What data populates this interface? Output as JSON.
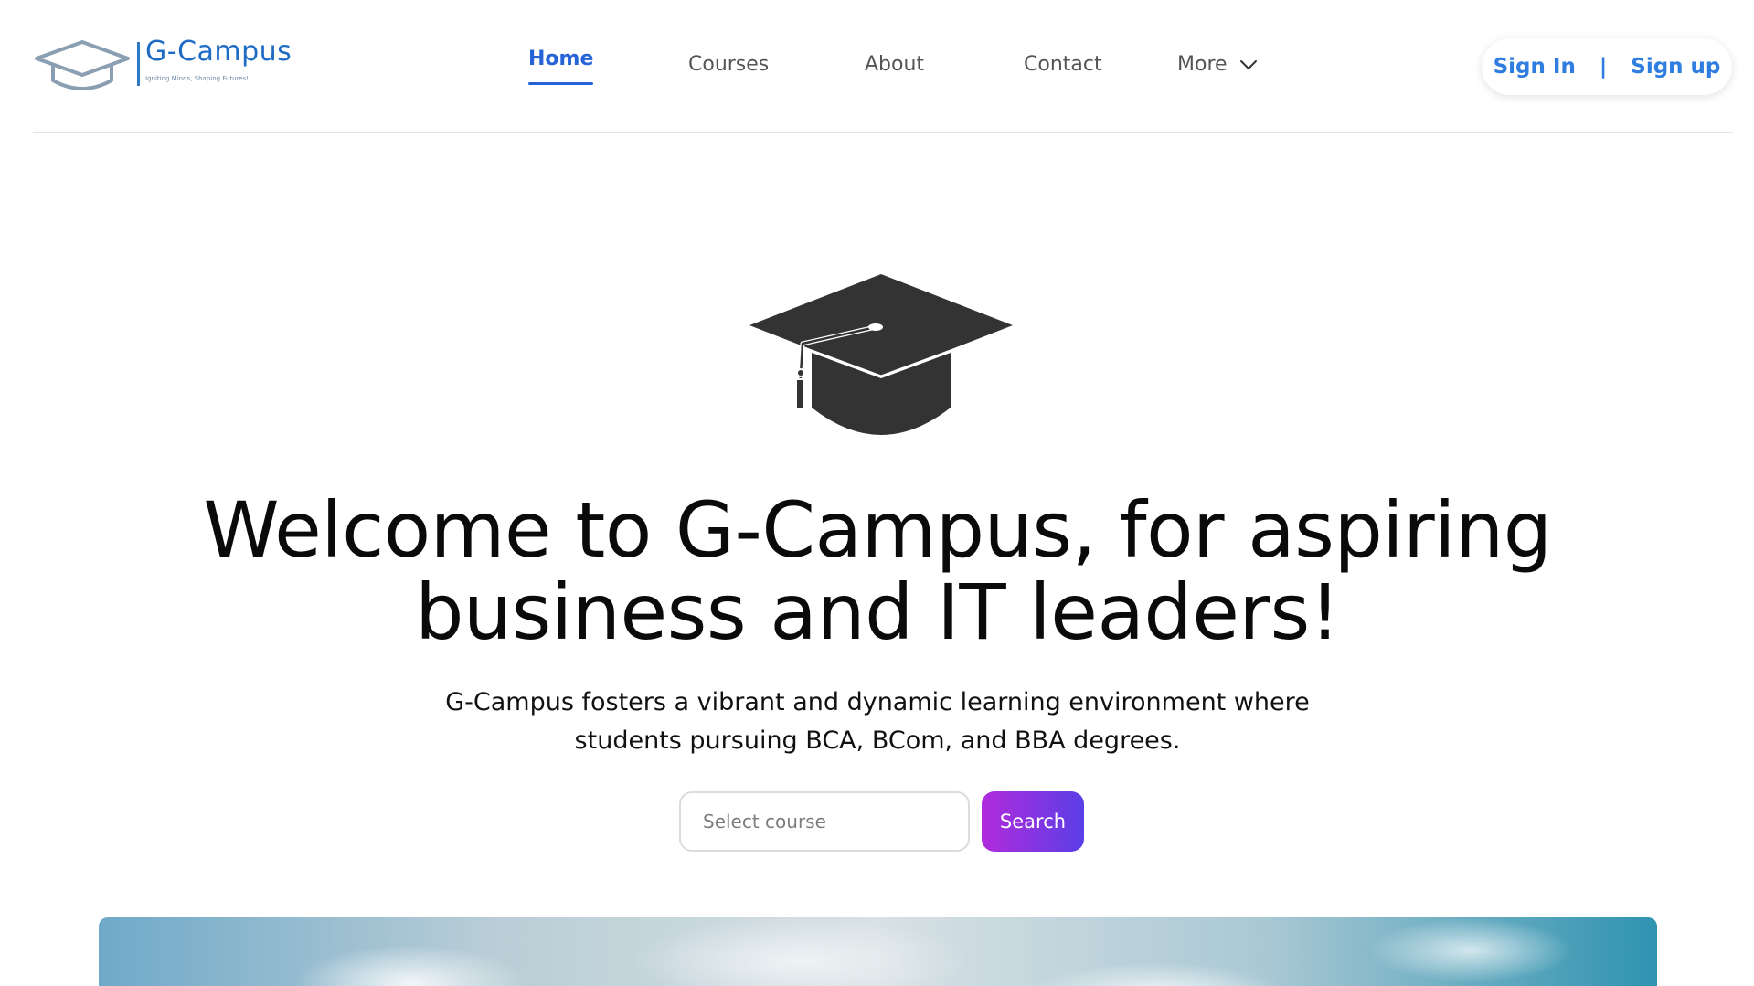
{
  "brand": {
    "name": "G-Campus",
    "tagline": "Igniting Minds, Shaping Futures!",
    "primary_color": "#2563d6",
    "logo_icon": "graduation-cap-icon"
  },
  "nav": {
    "items": [
      {
        "label": "Home",
        "active": true
      },
      {
        "label": "Courses",
        "active": false
      },
      {
        "label": "About",
        "active": false
      },
      {
        "label": "Contact",
        "active": false
      },
      {
        "label": "More",
        "active": false,
        "icon": "chevron-down-icon"
      }
    ]
  },
  "auth": {
    "sign_in": "Sign In",
    "separator": "|",
    "sign_up": "Sign up",
    "color": "#2f7de0"
  },
  "hero": {
    "icon": "graduation-cap-icon",
    "title": "Welcome to G-Campus, for aspiring business and IT leaders!",
    "subtitle": "G-Campus fosters a vibrant and dynamic learning environment where students pursuing BCA, BCom, and BBA degrees.",
    "search": {
      "value": "",
      "placeholder": "Select course",
      "button_label": "Search",
      "button_gradient": [
        "#b12bdc",
        "#5b3ee6"
      ]
    },
    "image": "sky-clouds-image"
  }
}
